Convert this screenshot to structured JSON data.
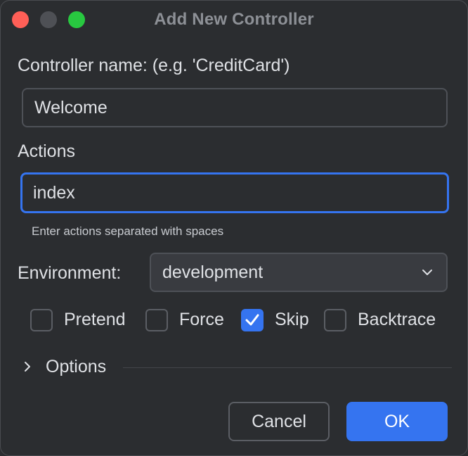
{
  "window": {
    "title": "Add New Controller"
  },
  "controller_name": {
    "label": "Controller name: (e.g. 'CreditCard')",
    "value": "Welcome"
  },
  "actions": {
    "label": "Actions",
    "value": "index",
    "hint": "Enter actions separated with spaces"
  },
  "environment": {
    "label": "Environment:",
    "selected": "development"
  },
  "checkboxes": [
    {
      "label": "Pretend",
      "checked": false
    },
    {
      "label": "Force",
      "checked": false
    },
    {
      "label": "Skip",
      "checked": true
    },
    {
      "label": "Backtrace",
      "checked": false
    }
  ],
  "options": {
    "label": "Options",
    "expanded": false
  },
  "buttons": {
    "cancel_label": "Cancel",
    "ok_label": "OK"
  },
  "colors": {
    "accent": "#3574f0",
    "close": "#ff5f57",
    "zoom": "#28c840",
    "background": "#2b2d30"
  },
  "icons": {
    "select_arrow": "chevron-down-icon",
    "options_toggle": "chevron-right-icon",
    "checkmark": "checkmark-icon"
  }
}
